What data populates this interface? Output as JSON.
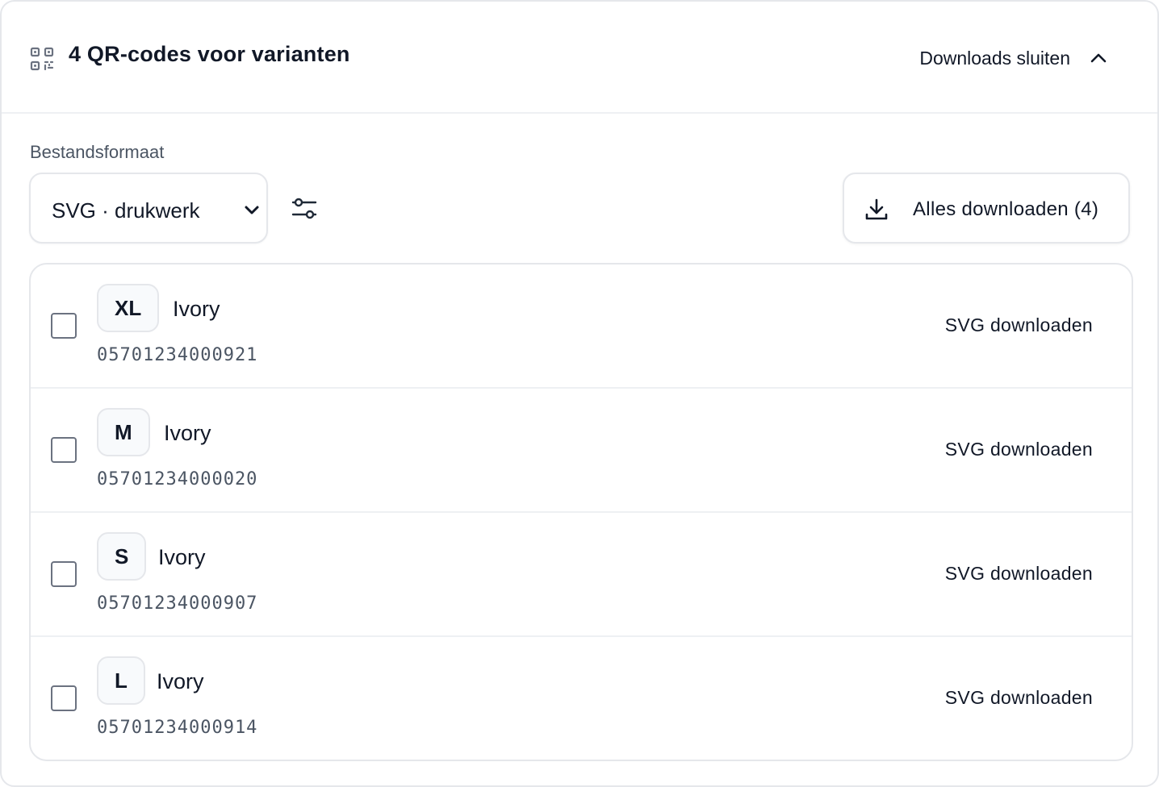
{
  "header": {
    "title": "4 QR-codes voor varianten",
    "toggle_label": "Downloads sluiten",
    "qr_icon": "qr-code-icon",
    "toggle_icon": "chevron-up-icon"
  },
  "format": {
    "label": "Bestandsformaat",
    "selected": "SVG · drukwerk",
    "settings_icon": "sliders-icon"
  },
  "download_all": {
    "label": "Alles downloaden (4)",
    "icon": "download-icon"
  },
  "variants": [
    {
      "size": "XL",
      "color": "Ivory",
      "code": "05701234000921",
      "action": "SVG downloaden",
      "checked": false
    },
    {
      "size": "M",
      "color": "Ivory",
      "code": "05701234000020",
      "action": "SVG downloaden",
      "checked": false
    },
    {
      "size": "S",
      "color": "Ivory",
      "code": "05701234000907",
      "action": "SVG downloaden",
      "checked": false
    },
    {
      "size": "L",
      "color": "Ivory",
      "code": "05701234000914",
      "action": "SVG downloaden",
      "checked": false
    }
  ],
  "colors": {
    "text": "#111827",
    "muted": "#4b5563",
    "border": "#e5e7eb",
    "badge_bg": "#f8fafc"
  }
}
